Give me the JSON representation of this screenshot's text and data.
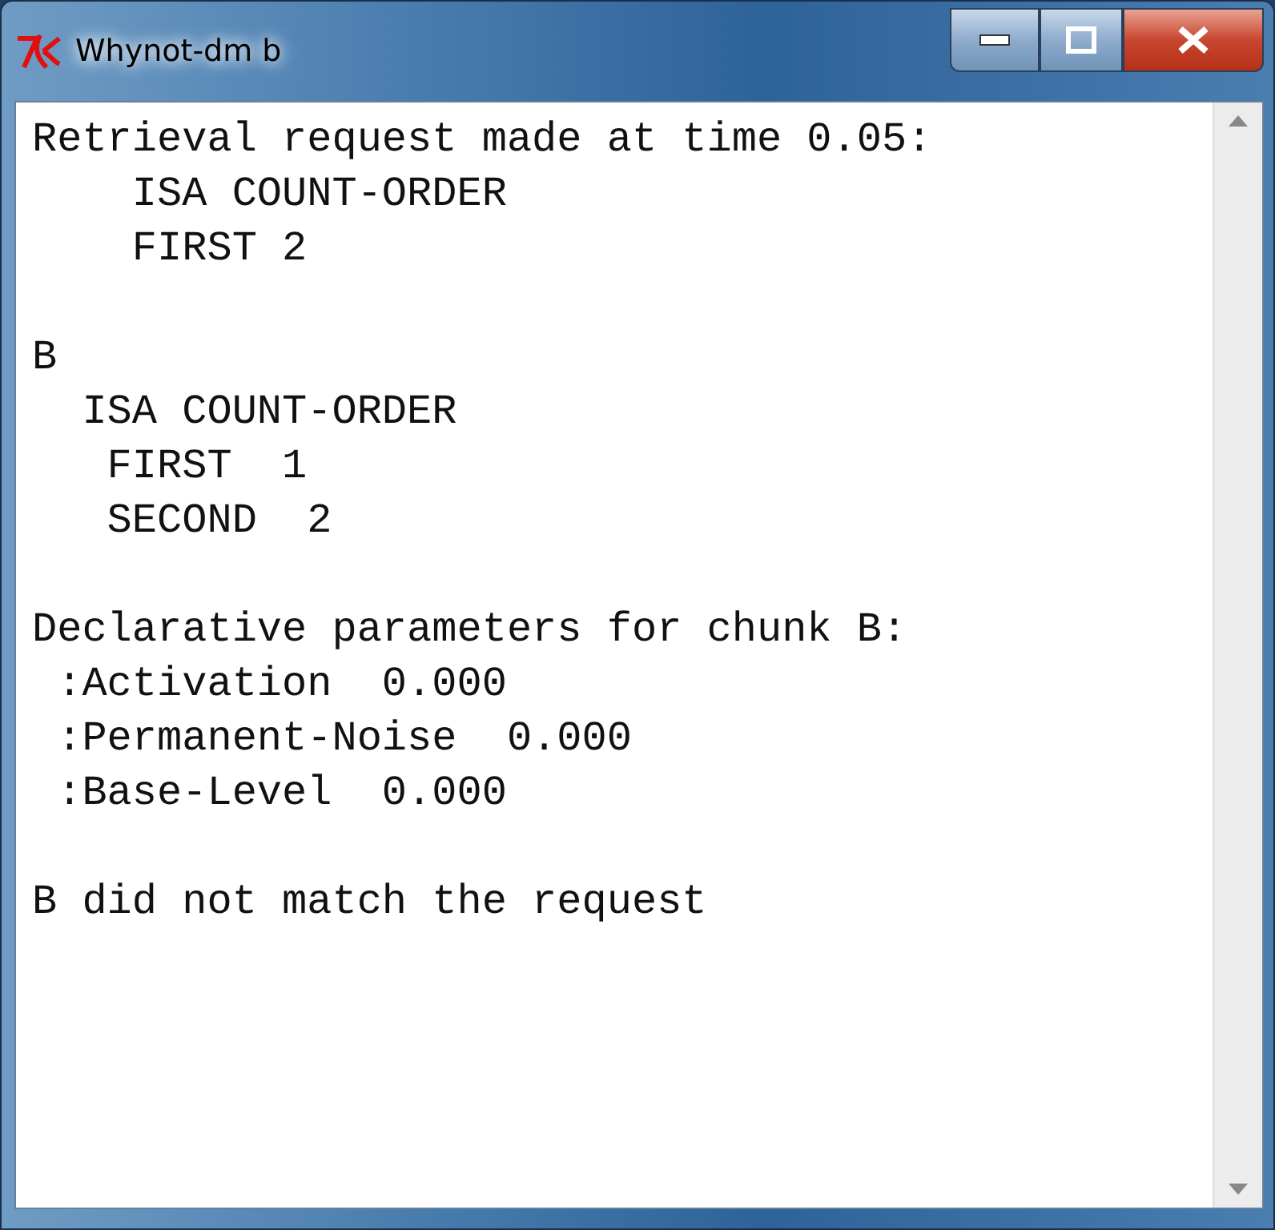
{
  "window": {
    "title": "Whynot-dm b"
  },
  "output": {
    "paragraphs": [
      [
        "Retrieval request made at time 0.05:",
        "    ISA COUNT-ORDER",
        "    FIRST 2"
      ],
      [
        "B",
        "  ISA COUNT-ORDER",
        "   FIRST  1",
        "   SECOND  2"
      ],
      [
        "Declarative parameters for chunk B:",
        " :Activation  0.000",
        " :Permanent-Noise  0.000",
        " :Base-Level  0.000"
      ],
      [
        "B did not match the request"
      ]
    ]
  }
}
